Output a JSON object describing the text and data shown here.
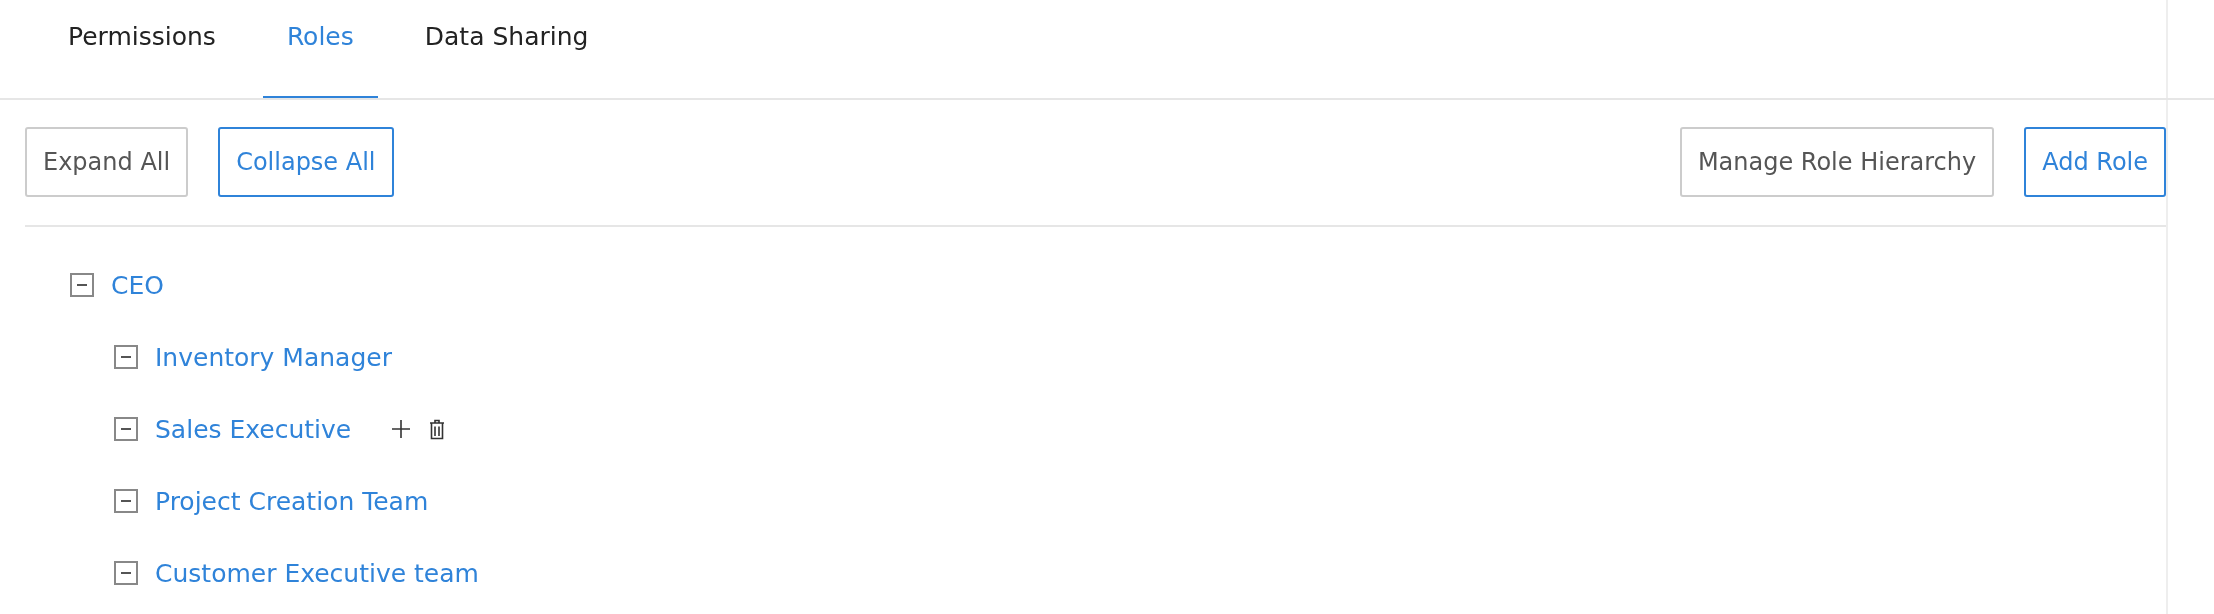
{
  "tabs": [
    {
      "label": "Permissions",
      "selected": false
    },
    {
      "label": "Roles",
      "selected": true
    },
    {
      "label": "Data Sharing",
      "selected": false
    }
  ],
  "toolbar": {
    "left_buttons": [
      {
        "label": "Expand All",
        "primary": false
      },
      {
        "label": "Collapse All",
        "primary": true
      }
    ],
    "right_buttons": [
      {
        "label": "Manage Role Hierarchy",
        "primary": false
      },
      {
        "label": "Add Role",
        "primary": true
      }
    ]
  },
  "role_tree": [
    {
      "label": "CEO",
      "expanded": true,
      "show_actions": false,
      "children": [
        {
          "label": "Inventory Manager",
          "expanded": true,
          "show_actions": false
        },
        {
          "label": "Sales Executive",
          "expanded": true,
          "show_actions": true
        },
        {
          "label": "Project Creation Team",
          "expanded": true,
          "show_actions": false
        },
        {
          "label": "Customer Executive team",
          "expanded": true,
          "show_actions": false
        }
      ]
    }
  ]
}
